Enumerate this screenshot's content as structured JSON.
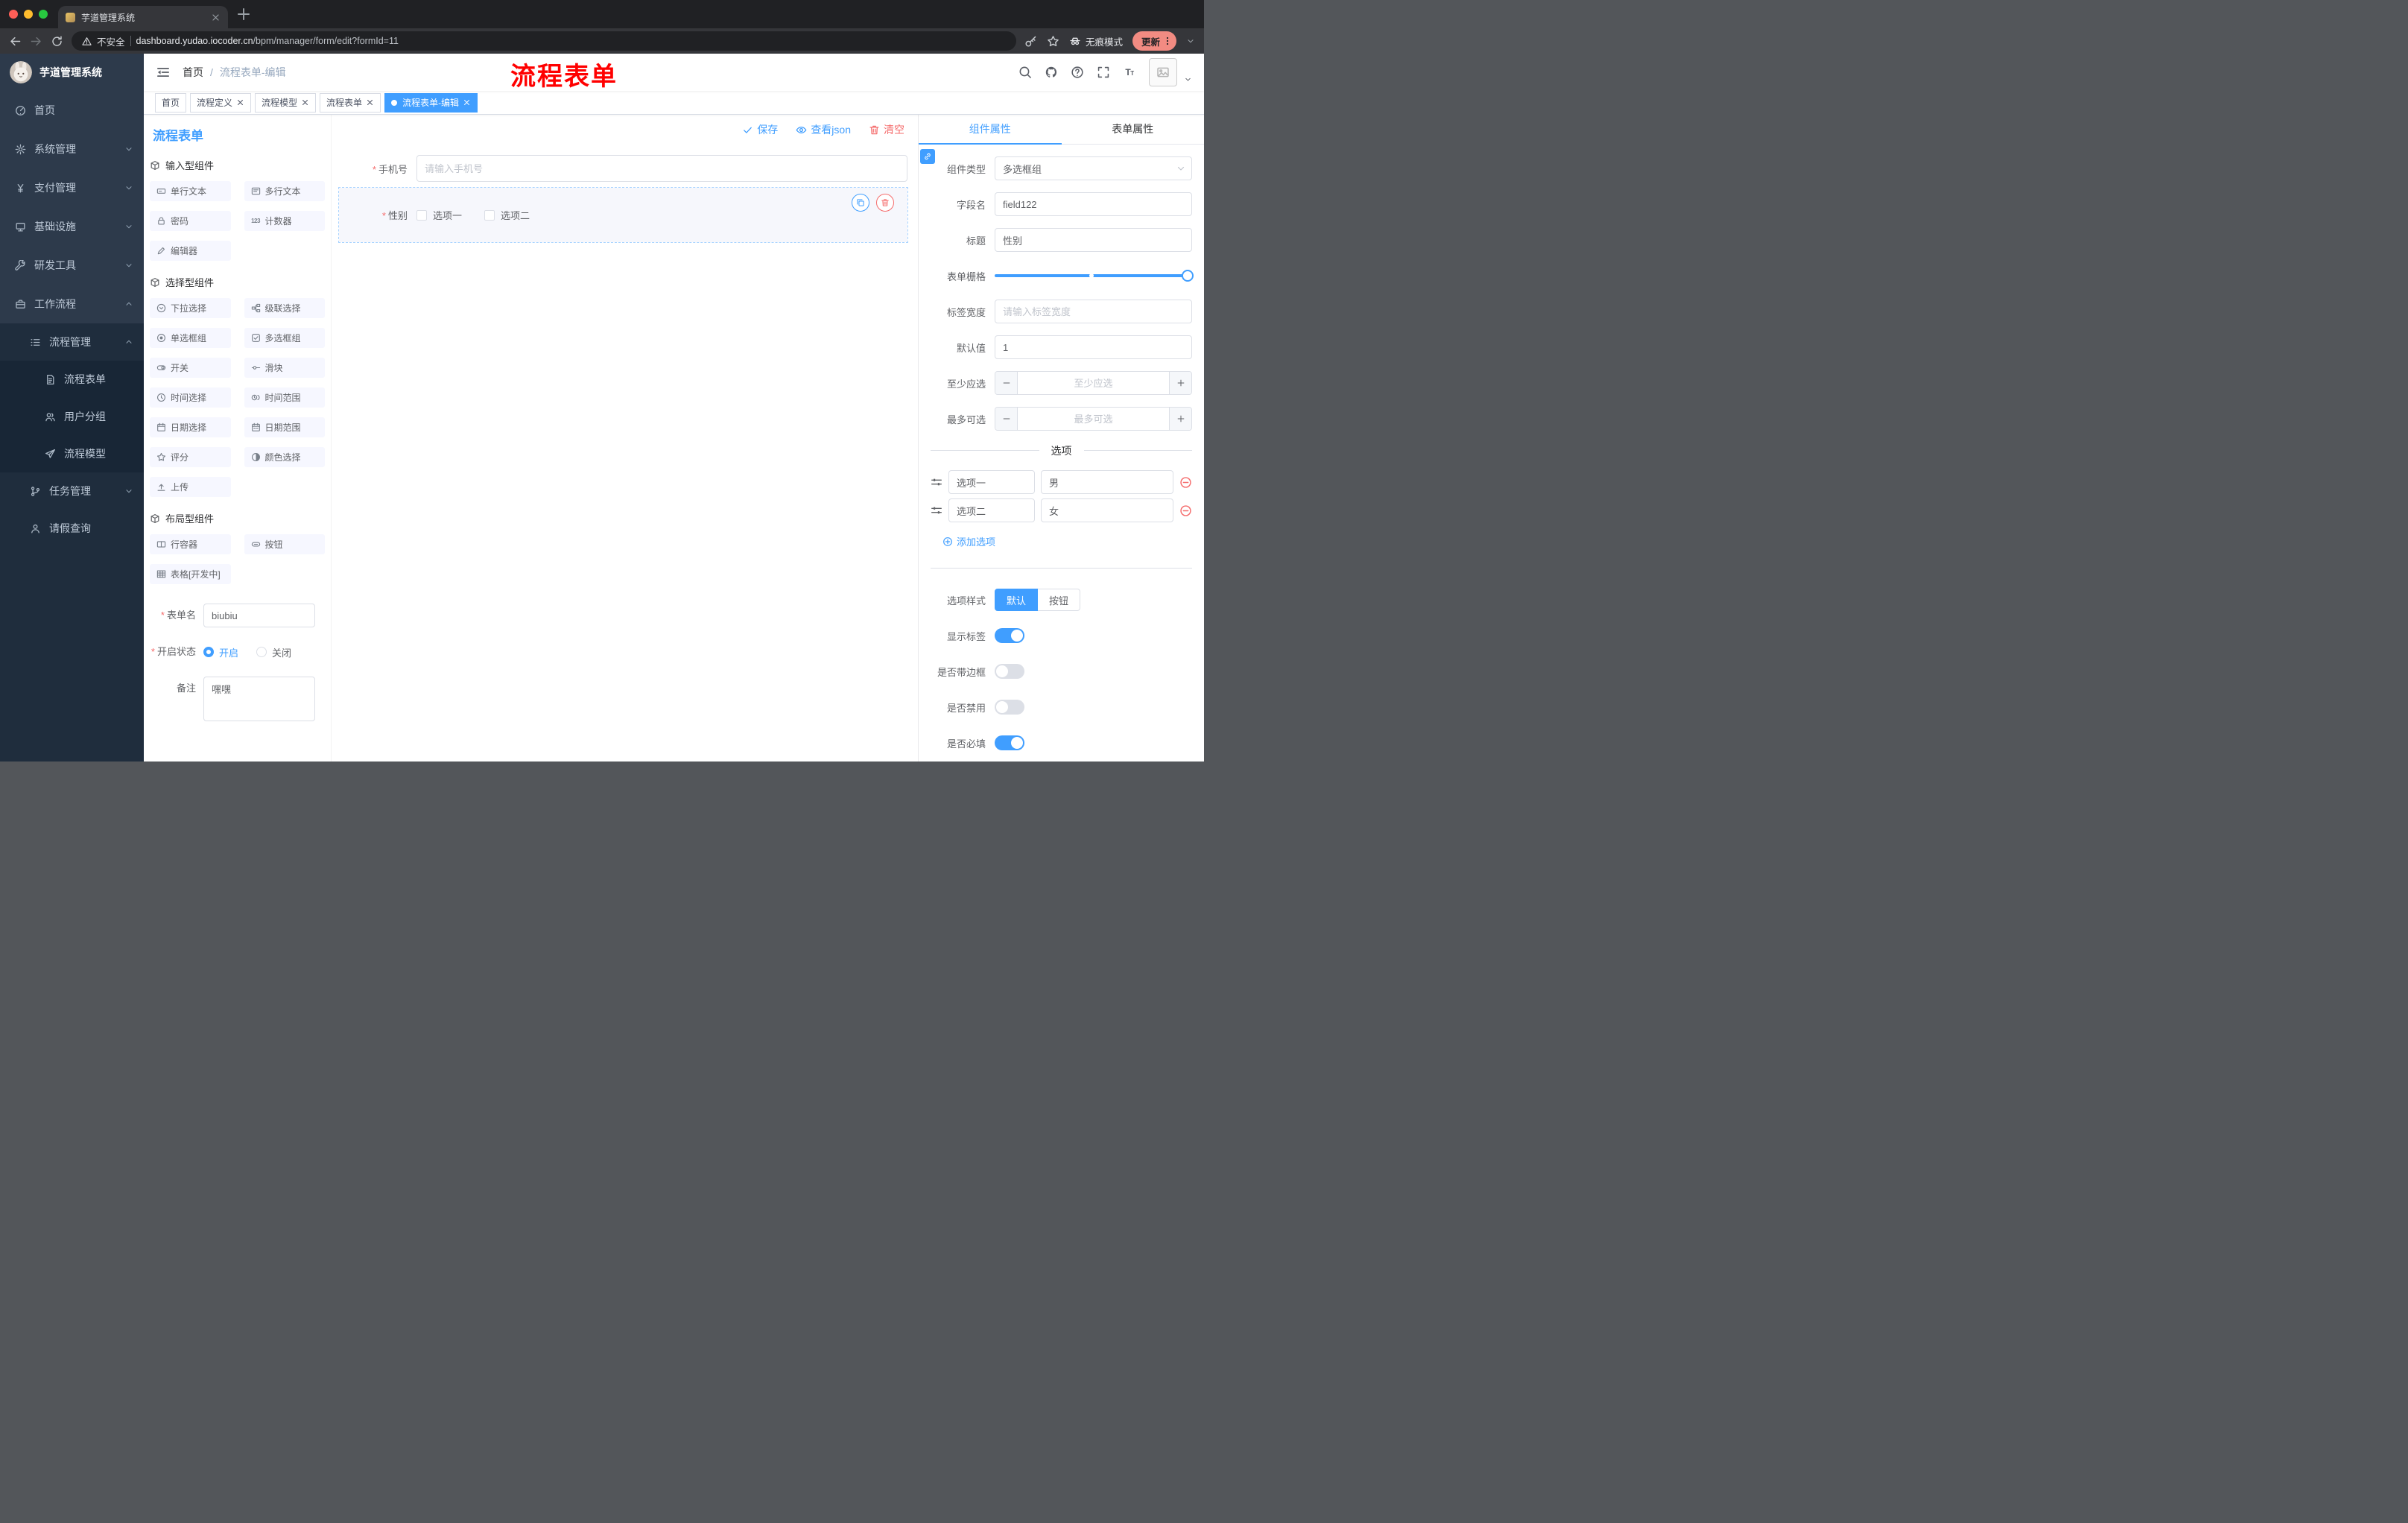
{
  "browser": {
    "tab_title": "芋道管理系统",
    "security_label": "不安全",
    "url_host": "dashboard.yudao.iocoder.cn",
    "url_path": "/bpm/manager/form/edit?formId=11",
    "incognito_label": "无痕模式",
    "update_label": "更新"
  },
  "sidebar": {
    "logo_title": "芋道管理系统",
    "items": [
      {
        "label": "首页",
        "icon": "dashboard",
        "level": 0
      },
      {
        "label": "系统管理",
        "icon": "gear",
        "level": 0,
        "chevron": "down"
      },
      {
        "label": "支付管理",
        "icon": "yen",
        "level": 0,
        "chevron": "down"
      },
      {
        "label": "基础设施",
        "icon": "infra",
        "level": 0,
        "chevron": "down"
      },
      {
        "label": "研发工具",
        "icon": "tool",
        "level": 0,
        "chevron": "down"
      },
      {
        "label": "工作流程",
        "icon": "briefcase",
        "level": 0,
        "chevron": "up"
      },
      {
        "label": "流程管理",
        "icon": "list",
        "level": 1,
        "chevron": "up"
      },
      {
        "label": "流程表单",
        "icon": "document",
        "level": 2
      },
      {
        "label": "用户分组",
        "icon": "users",
        "level": 2
      },
      {
        "label": "流程模型",
        "icon": "send",
        "level": 2
      },
      {
        "label": "任务管理",
        "icon": "branch",
        "level": 1,
        "chevron": "down"
      },
      {
        "label": "请假查询",
        "icon": "user",
        "level": 1
      }
    ]
  },
  "header": {
    "breadcrumb": [
      "首页",
      "流程表单-编辑"
    ],
    "annotation": "流程表单"
  },
  "tags": [
    {
      "label": "首页",
      "closable": false,
      "active": false
    },
    {
      "label": "流程定义",
      "closable": true,
      "active": false
    },
    {
      "label": "流程模型",
      "closable": true,
      "active": false
    },
    {
      "label": "流程表单",
      "closable": true,
      "active": false
    },
    {
      "label": "流程表单-编辑",
      "closable": true,
      "active": true
    }
  ],
  "palette": {
    "title": "流程表单",
    "groups": [
      {
        "title": "输入型组件",
        "items": [
          {
            "label": "单行文本",
            "icon": "input"
          },
          {
            "label": "多行文本",
            "icon": "textarea"
          },
          {
            "label": "密码",
            "icon": "lock"
          },
          {
            "label": "计数器",
            "icon": "counter"
          },
          {
            "label": "编辑器",
            "icon": "editor"
          }
        ]
      },
      {
        "title": "选择型组件",
        "items": [
          {
            "label": "下拉选择",
            "icon": "dropdown"
          },
          {
            "label": "级联选择",
            "icon": "cascade"
          },
          {
            "label": "单选框组",
            "icon": "radio"
          },
          {
            "label": "多选框组",
            "icon": "checkbox"
          },
          {
            "label": "开关",
            "icon": "switch"
          },
          {
            "label": "滑块",
            "icon": "slider"
          },
          {
            "label": "时间选择",
            "icon": "time"
          },
          {
            "label": "时间范围",
            "icon": "time-range"
          },
          {
            "label": "日期选择",
            "icon": "date"
          },
          {
            "label": "日期范围",
            "icon": "date-range"
          },
          {
            "label": "评分",
            "icon": "star"
          },
          {
            "label": "颜色选择",
            "icon": "color"
          },
          {
            "label": "上传",
            "icon": "upload"
          }
        ]
      },
      {
        "title": "布局型组件",
        "items": [
          {
            "label": "行容器",
            "icon": "row"
          },
          {
            "label": "按钮",
            "icon": "button"
          },
          {
            "label": "表格[开发中]",
            "icon": "table"
          }
        ]
      }
    ],
    "form": {
      "name_label": "表单名",
      "name_value": "biubiu",
      "status_label": "开启状态",
      "status_options": [
        "开启",
        "关闭"
      ],
      "status_selected": "开启",
      "remark_label": "备注",
      "remark_value": "嘿嘿"
    }
  },
  "canvas": {
    "toolbar": [
      {
        "label": "保存",
        "icon": "check"
      },
      {
        "label": "查看json",
        "icon": "eye"
      },
      {
        "label": "清空",
        "icon": "trash"
      }
    ],
    "phone_field": {
      "label": "手机号",
      "required": true,
      "placeholder": "请输入手机号"
    },
    "gender_field": {
      "label": "性别",
      "required": true,
      "options": [
        {
          "label": "选项一",
          "checked": false
        },
        {
          "label": "选项二",
          "checked": false
        }
      ]
    }
  },
  "inspector": {
    "tabs": [
      {
        "label": "组件属性",
        "active": true
      },
      {
        "label": "表单属性",
        "active": false
      }
    ],
    "fields": {
      "type": {
        "label": "组件类型",
        "value": "多选框组"
      },
      "field_name": {
        "label": "字段名",
        "value": "field122"
      },
      "title": {
        "label": "标题",
        "value": "性别"
      },
      "grid": {
        "label": "表单栅格",
        "value": 24,
        "max": 24,
        "stop": 12
      },
      "label_width": {
        "label": "标签宽度",
        "placeholder": "请输入标签宽度"
      },
      "default_value": {
        "label": "默认值",
        "value": "1"
      },
      "min_select": {
        "label": "至少应选",
        "placeholder": "至少应选"
      },
      "max_select": {
        "label": "最多可选",
        "placeholder": "最多可选"
      }
    },
    "options_section": {
      "divider_label": "选项",
      "options": [
        {
          "name": "选项一",
          "value": "男"
        },
        {
          "name": "选项二",
          "value": "女"
        }
      ],
      "add_label": "添加选项"
    },
    "style_row": {
      "label": "选项样式",
      "options": [
        "默认",
        "按钮"
      ],
      "selected": "默认"
    },
    "switches": [
      {
        "label": "显示标签",
        "on": true
      },
      {
        "label": "是否带边框",
        "on": false
      },
      {
        "label": "是否禁用",
        "on": false
      },
      {
        "label": "是否必填",
        "on": true
      }
    ]
  },
  "colors": {
    "primary": "#409EFF",
    "danger": "#F56C6C",
    "annotation": "#FF0000",
    "sidebar_bg": "#2D3A4B",
    "tag_active": "#409EFF"
  }
}
